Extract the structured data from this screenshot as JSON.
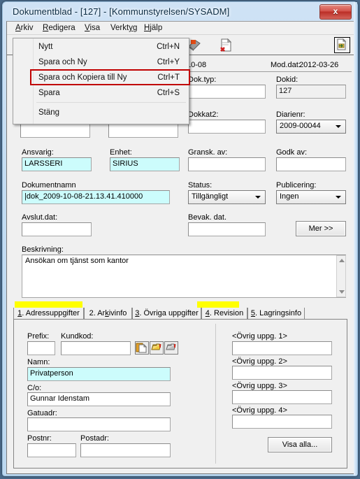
{
  "window": {
    "title": "Dokumentblad - [127] - [Kommunstyrelsen/SYSADM]",
    "close_label": "x"
  },
  "menubar": {
    "items": [
      {
        "label": "Arkiv",
        "mnemonic": "A"
      },
      {
        "label": "Redigera",
        "mnemonic": "R"
      },
      {
        "label": "Visa",
        "mnemonic": "V"
      },
      {
        "label": "Verktyg",
        "mnemonic": "y"
      },
      {
        "label": "Hjälp",
        "mnemonic": "H"
      }
    ]
  },
  "toolbar": {
    "icons": [
      "new-document-icon",
      "save-icon",
      "delete-document-icon"
    ],
    "right_button": "document-export-icon"
  },
  "open_menu": {
    "name": "Arkiv",
    "items": [
      {
        "label": "Nytt",
        "accel": "Ctrl+N",
        "highlighted": false
      },
      {
        "label": "Spara och Ny",
        "accel": "Ctrl+Y",
        "highlighted": false
      },
      {
        "label": "Spara och Kopiera till Ny",
        "accel": "Ctrl+T",
        "highlighted": true
      },
      {
        "label": "Spara",
        "accel": "Ctrl+S",
        "highlighted": false
      },
      {
        "label": "Stäng",
        "accel": "",
        "highlighted": false
      }
    ],
    "highlight_color": "#c00000"
  },
  "header": {
    "left_date_tail": "10-08",
    "mod_label": "Mod.dat:",
    "mod_date": "2012-03-26"
  },
  "form": {
    "dok_typ": {
      "label": "Dok.typ:",
      "value": ""
    },
    "dokid": {
      "label": "Dokid:",
      "value": "127"
    },
    "dokkat2": {
      "label": "Dokkat2:",
      "value": ""
    },
    "diarienr": {
      "label": "Diarienr:",
      "value": "2009-00044"
    },
    "hidden_left": {
      "value": ""
    },
    "hidden_mid": {
      "value": ""
    },
    "ansvarig": {
      "label": "Ansvarig:",
      "value": "LARSSERI"
    },
    "enhet": {
      "label": "Enhet:",
      "value": "SIRIUS"
    },
    "gransk_av": {
      "label": "Gransk. av:",
      "value": ""
    },
    "godk_av": {
      "label": "Godk av:",
      "value": ""
    },
    "dokumentnamn": {
      "label": "Dokumentnamn",
      "value": "|dok_2009-10-08-21.13.41.410000"
    },
    "status": {
      "label": "Status:",
      "value": "Tillgängligt"
    },
    "publicering": {
      "label": "Publicering:",
      "value": "Ingen"
    },
    "avslut_dat": {
      "label": "Avslut.dat:",
      "value": ""
    },
    "bevak_dat": {
      "label": "Bevak. dat.",
      "value": ""
    },
    "mer_button": "Mer >>",
    "beskrivning": {
      "label": "Beskrivning:",
      "value": "Ansökan om tjänst som kantor"
    }
  },
  "tabs": [
    {
      "label": "1. Adressuppgifter",
      "mnemonic": "1",
      "selected": true,
      "marked": true
    },
    {
      "label": "2. Arkivinfo",
      "mnemonic": "k",
      "selected": false,
      "marked": false
    },
    {
      "label": "3. Övriga uppgifter",
      "mnemonic": "3",
      "selected": false,
      "marked": false
    },
    {
      "label": "4. Revision",
      "mnemonic": "4",
      "selected": false,
      "marked": true
    },
    {
      "label": "5. Lagringsinfo",
      "mnemonic": "5",
      "selected": false,
      "marked": false
    }
  ],
  "address_tab": {
    "prefix": {
      "label": "Prefix:",
      "value": ""
    },
    "kundkod": {
      "label": "Kundkod:",
      "value": ""
    },
    "namn": {
      "label": "Namn:",
      "value": "Privatperson"
    },
    "co": {
      "label": "C/o:",
      "value": "Gunnar Idenstam"
    },
    "gatuadr": {
      "label": "Gatuadr:",
      "value": ""
    },
    "postnr": {
      "label": "Postnr:",
      "value": ""
    },
    "postadr": {
      "label": "Postadr:",
      "value": ""
    },
    "icon_buttons": [
      "copy-document-icon",
      "folder-icon",
      "printer-icon"
    ],
    "ovrig1": {
      "label": "<Övrig uppg. 1>",
      "value": ""
    },
    "ovrig2": {
      "label": "<Övrig uppg. 2>",
      "value": ""
    },
    "ovrig3": {
      "label": "<Övrig uppg. 3>",
      "value": ""
    },
    "ovrig4": {
      "label": "<Övrig uppg. 4>",
      "value": ""
    },
    "visa_alla_button": "Visa alla..."
  }
}
